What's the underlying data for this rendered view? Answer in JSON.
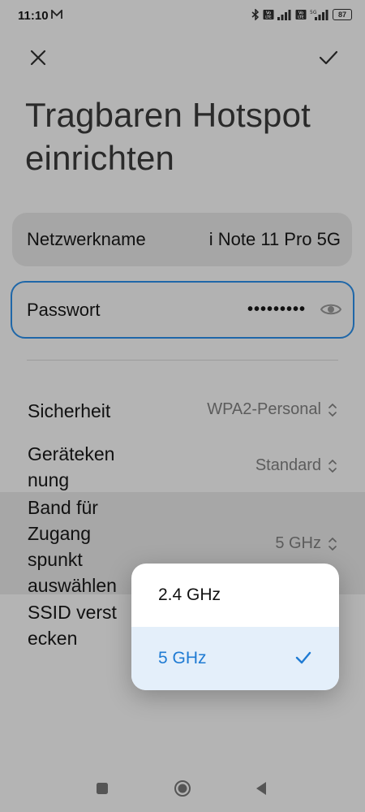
{
  "status": {
    "time": "11:10",
    "battery": "87",
    "icons": [
      "mail-icon",
      "bluetooth-icon",
      "volte-icon",
      "signal-icon",
      "volte-icon",
      "5g-signal-icon",
      "battery-icon"
    ]
  },
  "header": {
    "close_icon": "close-icon",
    "confirm_icon": "check-icon",
    "title": "Tragbaren Hotspot einrichten"
  },
  "network": {
    "label": "Netzwerkname",
    "value": "i Note 11 Pro 5G"
  },
  "password": {
    "label": "Passwort",
    "value": "•••••••••",
    "toggle_icon": "eye-icon"
  },
  "settings": {
    "security": {
      "label": "Sicherheit",
      "value": "WPA2-Personal"
    },
    "device": {
      "label": "Geräteken nung",
      "value": "Standard"
    },
    "band": {
      "label": "Band für Zugang spunkt auswählen",
      "value": "5 GHz"
    },
    "ssid": {
      "label": "SSID verst ecken"
    }
  },
  "band_popup": {
    "options": [
      {
        "label": "2.4 GHz",
        "selected": false
      },
      {
        "label": "5 GHz",
        "selected": true
      }
    ],
    "accent": "#1f7bd3"
  },
  "navbar": {
    "icons": [
      "recents-icon",
      "home-icon",
      "back-icon"
    ]
  }
}
